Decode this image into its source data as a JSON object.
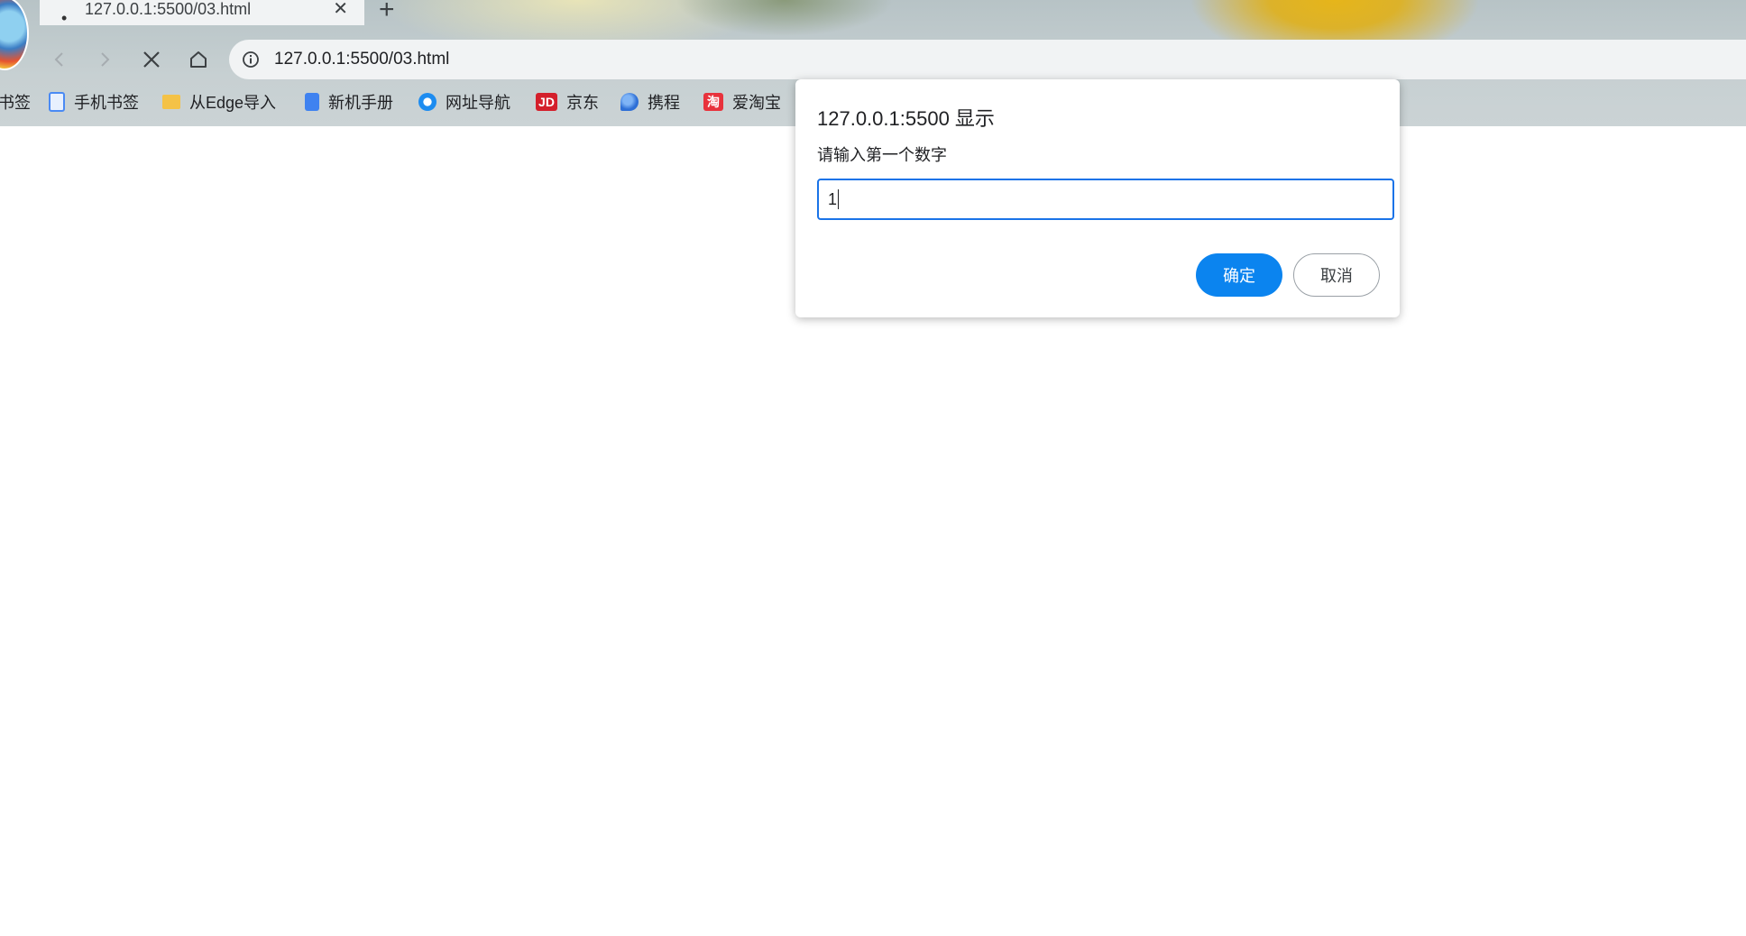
{
  "tab": {
    "favicon": "loading-dot",
    "title": "127.0.0.1:5500/03.html",
    "close": "✕"
  },
  "newtab": "+",
  "toolbar": {
    "back": "‹",
    "forward": "›",
    "stop": "✕"
  },
  "address": {
    "url": "127.0.0.1:5500/03.html"
  },
  "bookmarks": [
    {
      "label": "书签"
    },
    {
      "label": "手机书签"
    },
    {
      "label": "从Edge导入"
    },
    {
      "label": "新机手册"
    },
    {
      "label": "网址导航"
    },
    {
      "label": "京东",
      "icon_text": "JD"
    },
    {
      "label": "携程"
    },
    {
      "label": "爱淘宝",
      "icon_text": "淘"
    }
  ],
  "dialog": {
    "title": "127.0.0.1:5500 显示",
    "message": "请输入第一个数字",
    "input_value": "1",
    "ok_label": "确定",
    "cancel_label": "取消"
  },
  "colors": {
    "accent": "#0b84ef",
    "focus": "#1a73e8",
    "jd_red": "#d41f2b",
    "taobao_red": "#e8323c"
  }
}
